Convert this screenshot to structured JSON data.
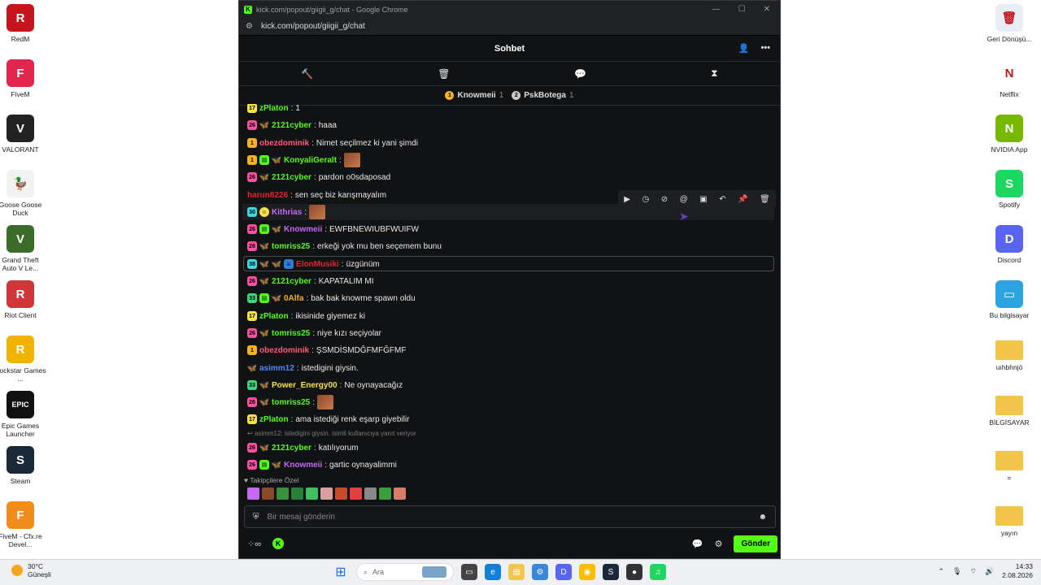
{
  "desktop_left": [
    {
      "name": "RedM",
      "color": "#c4161c",
      "glyph": "R"
    },
    {
      "name": "FiveM",
      "color": "#e2264d",
      "glyph": "F"
    },
    {
      "name": "VALORANT",
      "color": "#222",
      "glyph": "V"
    },
    {
      "name": "Goose Goose Duck",
      "color": "#f2f2f2",
      "glyph": "🦆"
    },
    {
      "name": "Grand Theft Auto V Le...",
      "color": "#3a6b2a",
      "glyph": "V"
    },
    {
      "name": "Riot Client",
      "color": "#d13639",
      "glyph": "R"
    },
    {
      "name": "Rockstar Games ...",
      "color": "#f2b300",
      "glyph": "R"
    },
    {
      "name": "Epic Games Launcher",
      "color": "#111",
      "glyph": "EPIC"
    },
    {
      "name": "Steam",
      "color": "#1b2838",
      "glyph": "S"
    },
    {
      "name": "FiveM - Cfx.re Devel...",
      "color": "#f28c1a",
      "glyph": "F"
    }
  ],
  "desktop_right": [
    {
      "name": "Geri Dönüşü...",
      "color": "#e8eef5",
      "glyph": "🗑"
    },
    {
      "name": "Netflix",
      "color": "#fff",
      "glyph": "N"
    },
    {
      "name": "NVIDIA App",
      "color": "#76b900",
      "glyph": "N"
    },
    {
      "name": "Spotify",
      "color": "#1ed760",
      "glyph": "S"
    },
    {
      "name": "Discord",
      "color": "#5865f2",
      "glyph": "D"
    },
    {
      "name": "Bu bilgisayar",
      "color": "#2aa3e0",
      "glyph": "▭"
    },
    {
      "name": "uıhbhnjö",
      "color": "#f3c64b",
      "glyph": ""
    },
    {
      "name": "BİLGİSAYAR",
      "color": "#f3c64b",
      "glyph": ""
    },
    {
      "name": "=",
      "color": "#f3c64b",
      "glyph": ""
    },
    {
      "name": "yayın",
      "color": "#f3c64b",
      "glyph": ""
    }
  ],
  "browser": {
    "title": "kick.com/popout/giigii_g/chat - Google Chrome",
    "url": "kick.com/popout/giigii_g/chat"
  },
  "chat": {
    "header": "Sohbet",
    "gifters": [
      {
        "rank": "1",
        "name": "Knowmeii",
        "count": "1",
        "color": "#f5b321"
      },
      {
        "rank": "2",
        "name": "PskBotega",
        "count": "1",
        "color": "#c9c9c9"
      }
    ],
    "messages": [
      {
        "user": "zPlaton",
        "color": "#53fc18",
        "text": "1",
        "badges": [
          "17"
        ]
      },
      {
        "user": "2121cyber",
        "color": "#53fc18",
        "text": "haaa",
        "badges": [
          "26",
          "fly"
        ]
      },
      {
        "user": "obezdominik",
        "color": "#ff5a7a",
        "text": "Nimet seçilmez ki yani şimdi",
        "badges": [
          "1"
        ]
      },
      {
        "user": "KonyaliGeralt",
        "color": "#53fc18",
        "text": "",
        "badges": [
          "1",
          "gift",
          "fly"
        ],
        "emote": true
      },
      {
        "user": "2121cyber",
        "color": "#53fc18",
        "text": "pardon o0sdaposad",
        "badges": [
          "26",
          "fly"
        ]
      },
      {
        "user": "harun8226",
        "color": "#e0252d",
        "text": "sen seç biz karışmayalım",
        "badges": []
      },
      {
        "user": "Kithrias",
        "color": "#c56af5",
        "text": "",
        "badges": [
          "30",
          "mask"
        ],
        "emote": true
      },
      {
        "user": "Knowmeii",
        "color": "#c56af5",
        "text": "EWFBNEWIUBFWUIFW",
        "badges": [
          "26",
          "gift",
          "fly"
        ]
      },
      {
        "user": "tomriss25",
        "color": "#53fc18",
        "text": "erkeği yok mu ben seçemem bunu",
        "badges": [
          "26",
          "fly"
        ]
      },
      {
        "user": "ElonMusiki",
        "color": "#e0252d",
        "text": "üzgünüm",
        "badges": [
          "38",
          "fly",
          "fly",
          "sword"
        ]
      },
      {
        "user": "2121cyber",
        "color": "#53fc18",
        "text": "KAPATALIM MI",
        "badges": [
          "26",
          "fly"
        ]
      },
      {
        "user": "0Alfa",
        "color": "#f5b321",
        "text": "bak bak knowme spawn oldu",
        "badges": [
          "33",
          "gift",
          "fly"
        ]
      },
      {
        "user": "zPlaton",
        "color": "#53fc18",
        "text": "ikisinide giyemez ki",
        "badges": [
          "17"
        ]
      },
      {
        "user": "tomriss25",
        "color": "#53fc18",
        "text": "niye kızı seçiyolar",
        "badges": [
          "26",
          "fly"
        ]
      },
      {
        "user": "obezdominik",
        "color": "#ff5a7a",
        "text": "ŞSMDİSMDĞFMFĞFMF",
        "badges": [
          "1"
        ]
      },
      {
        "user": "asimm12",
        "color": "#4b8bff",
        "text": "istedigini giysin.",
        "badges": [
          "fly"
        ]
      },
      {
        "user": "Power_Energy00",
        "color": "#f5e24b",
        "text": "Ne oynayacağız",
        "badges": [
          "33",
          "fly"
        ]
      },
      {
        "user": "tomriss25",
        "color": "#53fc18",
        "text": "",
        "badges": [
          "26",
          "fly"
        ],
        "emote": true
      },
      {
        "user": "zPlaton",
        "color": "#53fc18",
        "text": "ama istediği renk eşarp giyebilir",
        "badges": [
          "17"
        ]
      },
      {
        "user": "2121cyber",
        "color": "#53fc18",
        "text": "katılıyorum",
        "badges": [
          "26",
          "fly"
        ]
      },
      {
        "user": "Knowmeii",
        "color": "#c56af5",
        "text": "gartic oynayalimmi",
        "badges": [
          "26",
          "gift",
          "fly"
        ]
      }
    ],
    "reply_hint": "asimm12: istedigini giysin. isimli kullanıcıya yanıt veriyor",
    "followers_label": "Takipçilere Özel",
    "input_placeholder": "Bir mesaj gönderin",
    "send_label": "Gönder"
  },
  "taskbar": {
    "temp": "30°C",
    "weather": "Güneşli",
    "search": "Ara",
    "time": "14:33",
    "date": "2.08.2026"
  }
}
